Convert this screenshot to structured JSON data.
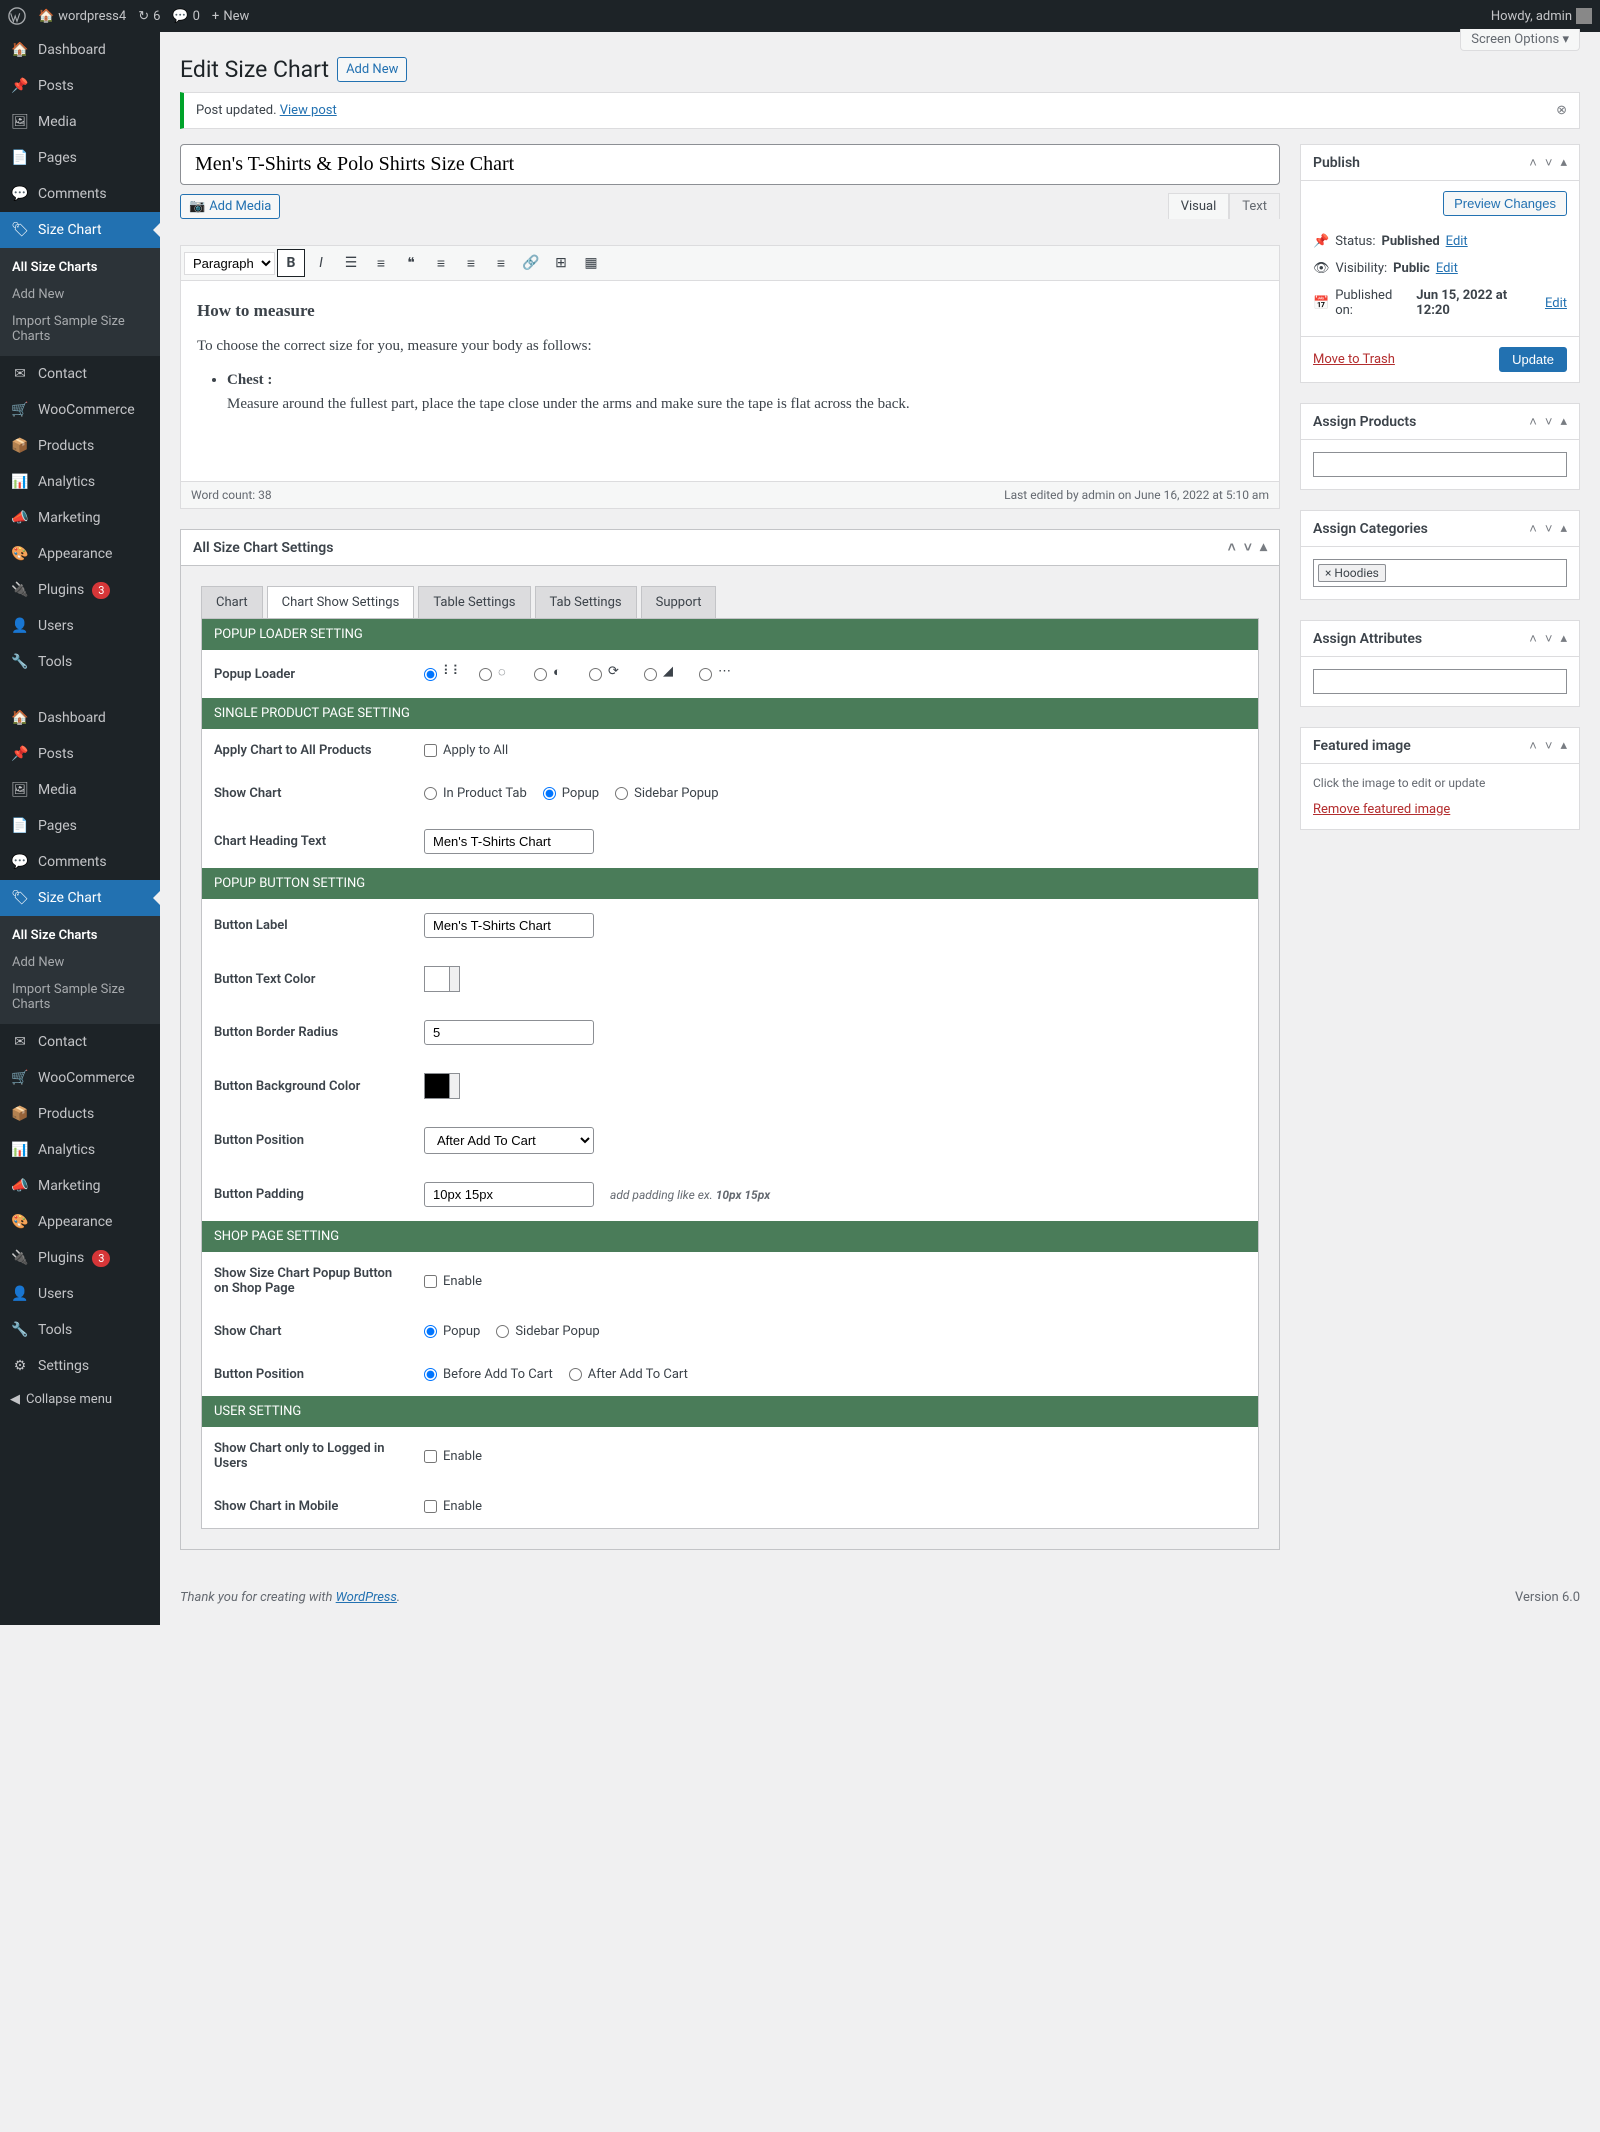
{
  "adminbar": {
    "site": "wordpress4",
    "updates": "6",
    "comments": "0",
    "new": "New",
    "howdy": "Howdy, admin"
  },
  "sidebar": {
    "items": [
      {
        "label": "Dashboard",
        "icon": "dash"
      },
      {
        "label": "Posts",
        "icon": "pin"
      },
      {
        "label": "Media",
        "icon": "media"
      },
      {
        "label": "Pages",
        "icon": "page"
      },
      {
        "label": "Comments",
        "icon": "comment"
      },
      {
        "label": "Size Chart",
        "icon": "tag",
        "active": true
      }
    ],
    "submenu": [
      {
        "label": "All Size Charts",
        "current": true
      },
      {
        "label": "Add New"
      },
      {
        "label": "Import Sample Size Charts"
      }
    ],
    "items2": [
      {
        "label": "Contact",
        "icon": "mail"
      },
      {
        "label": "WooCommerce",
        "icon": "woo"
      },
      {
        "label": "Products",
        "icon": "box"
      },
      {
        "label": "Analytics",
        "icon": "chart"
      },
      {
        "label": "Marketing",
        "icon": "mega"
      },
      {
        "label": "Appearance",
        "icon": "brush"
      },
      {
        "label": "Plugins",
        "icon": "plug",
        "badge": "3"
      },
      {
        "label": "Users",
        "icon": "user"
      },
      {
        "label": "Tools",
        "icon": "wrench"
      }
    ],
    "items3": [
      {
        "label": "Dashboard",
        "icon": "dash"
      },
      {
        "label": "Posts",
        "icon": "pin"
      },
      {
        "label": "Media",
        "icon": "media"
      },
      {
        "label": "Pages",
        "icon": "page"
      },
      {
        "label": "Comments",
        "icon": "comment"
      },
      {
        "label": "Size Chart",
        "icon": "tag",
        "active": true
      }
    ],
    "submenu2": [
      {
        "label": "All Size Charts",
        "current": true
      },
      {
        "label": "Add New"
      },
      {
        "label": "Import Sample Size Charts"
      }
    ],
    "items4": [
      {
        "label": "Contact",
        "icon": "mail"
      },
      {
        "label": "WooCommerce",
        "icon": "woo"
      },
      {
        "label": "Products",
        "icon": "box"
      },
      {
        "label": "Analytics",
        "icon": "chart"
      },
      {
        "label": "Marketing",
        "icon": "mega"
      },
      {
        "label": "Appearance",
        "icon": "brush"
      },
      {
        "label": "Plugins",
        "icon": "plug",
        "badge": "3"
      },
      {
        "label": "Users",
        "icon": "user"
      },
      {
        "label": "Tools",
        "icon": "wrench"
      },
      {
        "label": "Settings",
        "icon": "sliders"
      }
    ],
    "collapse": "Collapse menu"
  },
  "page": {
    "screen_options": "Screen Options ▾",
    "title": "Edit Size Chart",
    "add_new": "Add New",
    "notice": "Post updated.",
    "notice_link": "View post",
    "title_value": "Men's T-Shirts & Polo Shirts Size Chart"
  },
  "editor": {
    "add_media": "Add Media",
    "tab_visual": "Visual",
    "tab_text": "Text",
    "format": "Paragraph",
    "content_heading": "How to measure",
    "content_p": "To choose the correct size for you, measure your body as follows:",
    "content_li_bold": "Chest :",
    "content_li": "Measure around the fullest part, place the tape close under the arms and make sure the tape is flat across the back.",
    "word_count": "Word count: 38",
    "last_edited": "Last edited by admin on June 16, 2022 at 5:10 am"
  },
  "settings_title": "All Size Chart Settings",
  "tabs": [
    "Chart",
    "Chart Show Settings",
    "Table Settings",
    "Tab Settings",
    "Support"
  ],
  "sections": {
    "popup_loader": {
      "header": "POPUP LOADER SETTING",
      "label": "Popup Loader"
    },
    "single_product": {
      "header": "SINGLE PRODUCT PAGE SETTING",
      "apply_label": "Apply Chart to All Products",
      "apply_opt": "Apply to All",
      "show_label": "Show Chart",
      "show_opts": [
        "In Product Tab",
        "Popup",
        "Sidebar Popup"
      ],
      "heading_label": "Chart Heading Text",
      "heading_value": "Men's T-Shirts Chart"
    },
    "popup_button": {
      "header": "POPUP BUTTON SETTING",
      "label_label": "Button Label",
      "label_value": "Men's T-Shirts Chart",
      "text_color_label": "Button Text Color",
      "text_color_value": "#ffffff",
      "radius_label": "Button Border Radius",
      "radius_value": "5",
      "bg_label": "Button Background Color",
      "bg_value": "#000000",
      "pos_label": "Button Position",
      "pos_value": "After Add To Cart",
      "pad_label": "Button Padding",
      "pad_value": "10px 15px",
      "pad_hint_prefix": "add padding like ex. ",
      "pad_hint_bold": "10px 15px"
    },
    "shop_page": {
      "header": "SHOP PAGE SETTING",
      "show_btn_label": "Show Size Chart Popup Button on Shop Page",
      "show_btn_opt": "Enable",
      "show_chart_label": "Show Chart",
      "show_chart_opts": [
        "Popup",
        "Sidebar Popup"
      ],
      "pos_label": "Button Position",
      "pos_opts": [
        "Before Add To Cart",
        "After Add To Cart"
      ]
    },
    "user": {
      "header": "USER SETTING",
      "logged_label": "Show Chart only to Logged in Users",
      "logged_opt": "Enable",
      "mobile_label": "Show Chart in Mobile",
      "mobile_opt": "Enable"
    }
  },
  "publish": {
    "title": "Publish",
    "preview": "Preview Changes",
    "status_label": "Status:",
    "status_value": "Published",
    "edit": "Edit",
    "visibility_label": "Visibility:",
    "visibility_value": "Public",
    "pub_label": "Published on:",
    "pub_value": "Jun 15, 2022 at 12:20",
    "trash": "Move to Trash",
    "update": "Update"
  },
  "assign_products": {
    "title": "Assign Products"
  },
  "assign_categories": {
    "title": "Assign Categories",
    "tag": "× Hoodies"
  },
  "assign_attributes": {
    "title": "Assign Attributes"
  },
  "featured_image": {
    "title": "Featured image",
    "hint": "Click the image to edit or update",
    "remove": "Remove featured image"
  },
  "footer": {
    "thanks": "Thank you for creating with ",
    "wp": "WordPress",
    "version": "Version 6.0"
  }
}
